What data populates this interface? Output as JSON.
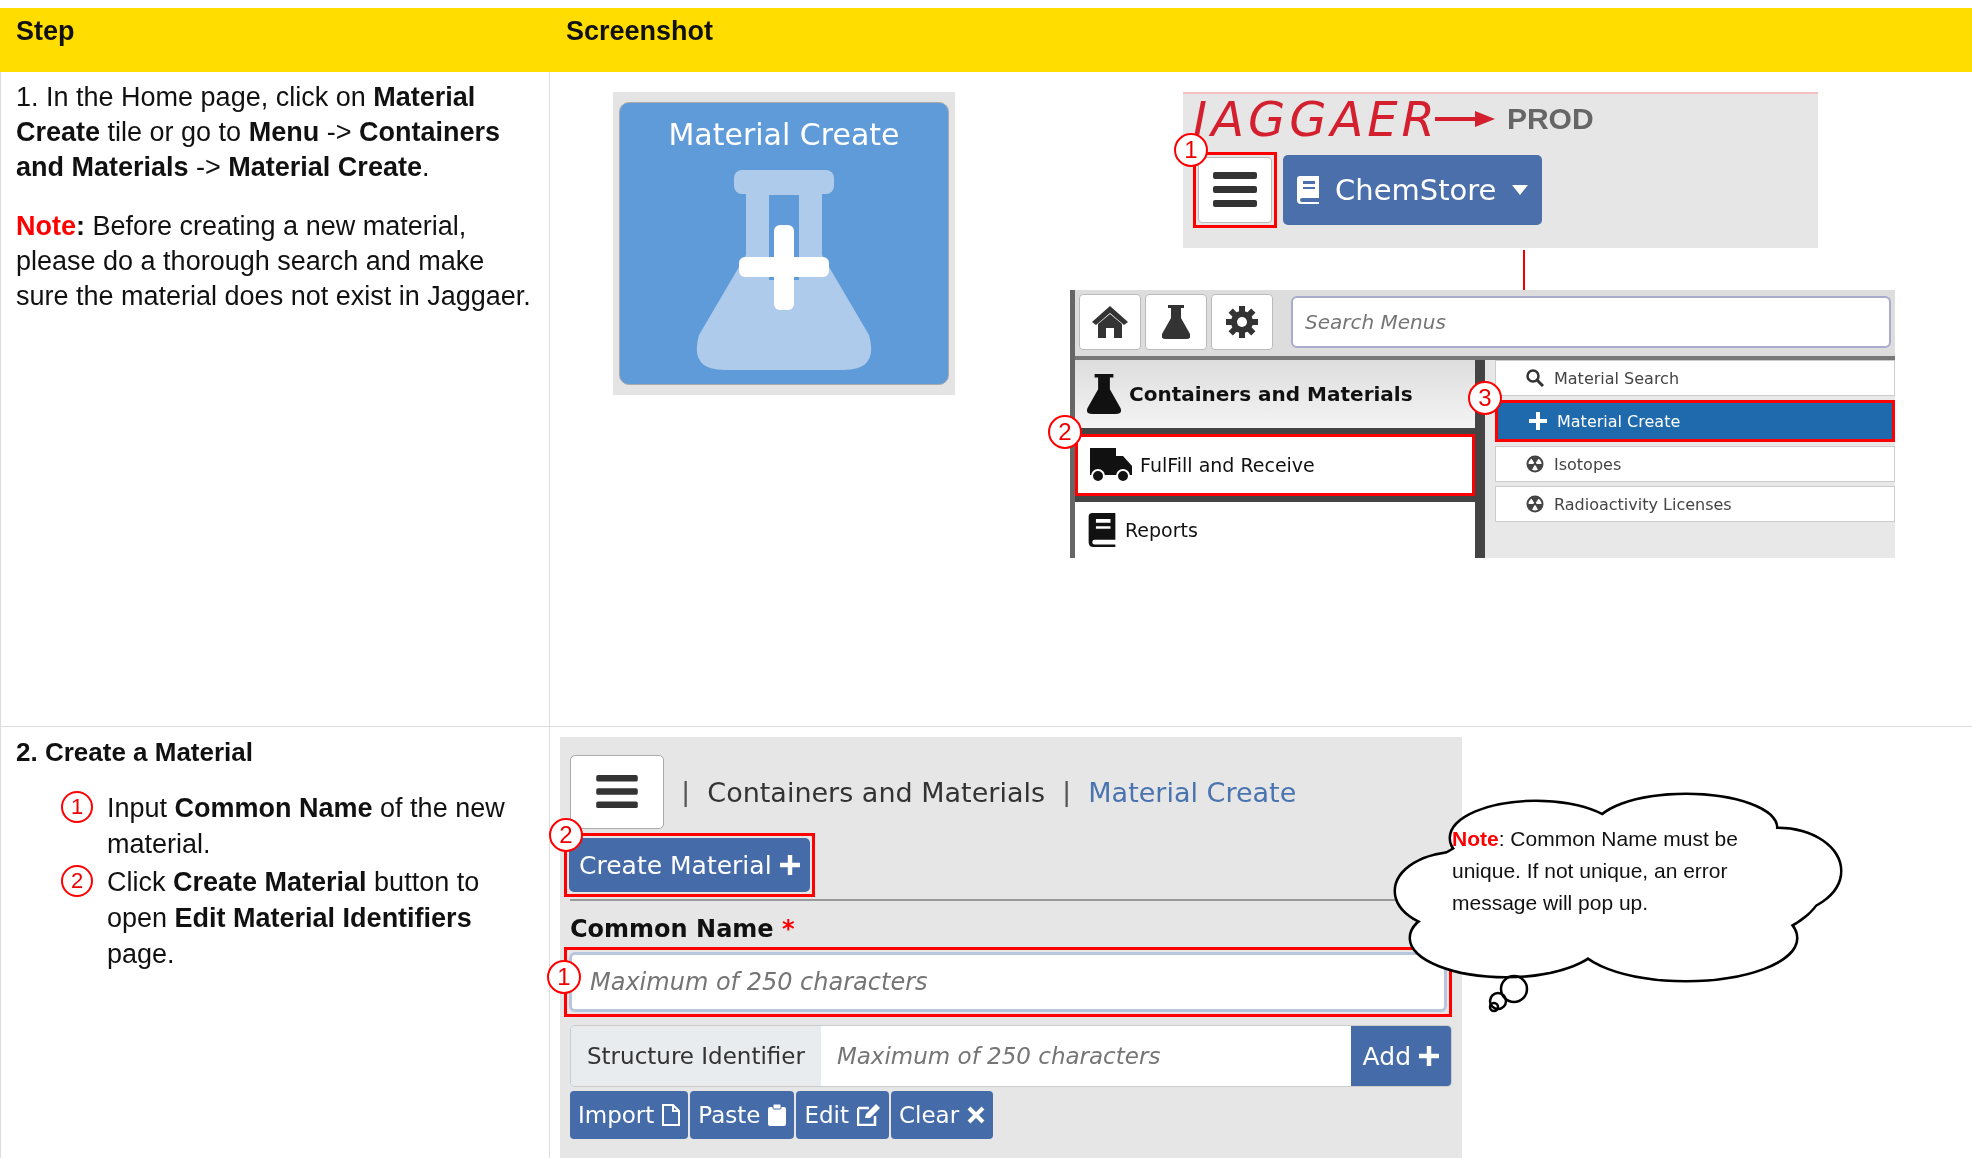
{
  "header": {
    "step": "Step",
    "screenshot": "Screenshot"
  },
  "step1": {
    "instruction": "1. In the Home page, click on **Material Create** tile or go to **Menu** -> **Containers and Materials** -> **Material Create**.",
    "note_label": "Note",
    "note": "**:** Before creating a new material, please do a thorough search and make sure the material does not exist in Jaggaer."
  },
  "tile": {
    "title": "Material Create"
  },
  "app_header": {
    "logo": "JAGGAER",
    "environment": "PROD",
    "menu_callout": "1",
    "app_button": "ChemStore"
  },
  "menu": {
    "search_placeholder": "Search Menus",
    "categories": [
      {
        "label": "Containers and Materials",
        "kind": "header",
        "highlighted": false
      },
      {
        "label": "FulFill and Receive",
        "kind": "item",
        "highlighted": true,
        "callout": "2"
      },
      {
        "label": "Reports",
        "kind": "item",
        "highlighted": false
      }
    ],
    "subitems": [
      {
        "label": "Material Search",
        "selected": false,
        "highlighted": false
      },
      {
        "label": "Material Create",
        "selected": true,
        "highlighted": true,
        "callout": "3"
      },
      {
        "label": "Isotopes",
        "selected": false,
        "highlighted": false
      },
      {
        "label": "Radioactivity Licenses",
        "selected": false,
        "highlighted": false
      }
    ]
  },
  "step2": {
    "title": "2. Create a Material",
    "items": [
      {
        "number": "1",
        "text": "Input **Common Name** of the new material."
      },
      {
        "number": "2",
        "text": "Click **Create Material** button to open **Edit Material Identifiers** page."
      }
    ]
  },
  "screen2": {
    "breadcrumb": [
      {
        "separator": "|",
        "label": "Containers and Materials",
        "current": false
      },
      {
        "separator": "|",
        "label": "Material Create",
        "current": true
      }
    ],
    "create_button": {
      "label": "Create Material",
      "callout": "2"
    },
    "common_name": {
      "label": "Common Name",
      "required": "*",
      "placeholder": "Maximum of 250 characters",
      "callout": "1"
    },
    "structure": {
      "label": "Structure Identifier",
      "placeholder": "Maximum of 250 characters",
      "button": "Add"
    },
    "actions": [
      "Import",
      "Paste",
      "Edit",
      "Clear"
    ]
  },
  "cloud": {
    "note_label": "Note",
    "text": ": Common Name must be unique. If not unique, an error message will pop up."
  }
}
